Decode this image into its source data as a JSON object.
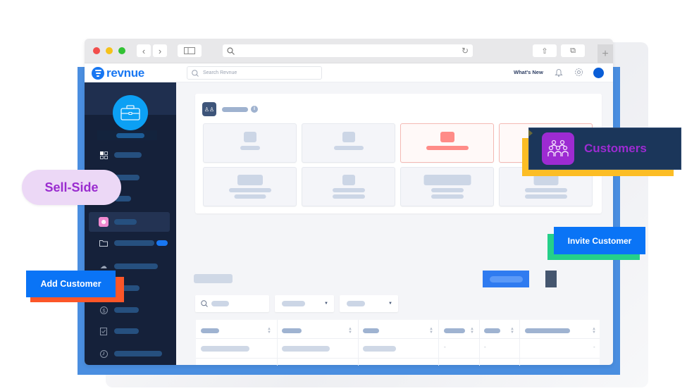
{
  "browser": {
    "url_placeholder": "",
    "icons": [
      "close",
      "minimize",
      "maximize",
      "back",
      "forward",
      "sidebar-toggle",
      "search",
      "reload",
      "share",
      "tabs",
      "new-tab"
    ]
  },
  "app": {
    "brand": "revnue",
    "search_placeholder": "Search Revnue",
    "whats_new": "What's New",
    "colors": {
      "brand": "#1877f2",
      "sidebar": "#15213a",
      "accent_purple": "#9d2bd2"
    }
  },
  "sidebar": {
    "items": [
      {
        "icon": "dashboard-grid",
        "active": false,
        "badge": false
      },
      {
        "icon": "item",
        "active": false,
        "badge": false
      },
      {
        "icon": "item",
        "active": false,
        "badge": false
      },
      {
        "icon": "customers",
        "active": true,
        "badge": false
      },
      {
        "icon": "folder",
        "active": false,
        "badge": true
      },
      {
        "icon": "cloud-settings",
        "active": false,
        "badge": false
      },
      {
        "icon": "item",
        "active": false,
        "badge": false
      },
      {
        "icon": "dollar-circle",
        "active": false,
        "badge": false
      },
      {
        "icon": "checklist",
        "active": false,
        "badge": false
      },
      {
        "icon": "clock",
        "active": false,
        "badge": false
      }
    ]
  },
  "callouts": {
    "customers": "Customers",
    "sell_side": "Sell-Side",
    "add_customer": "Add Customer",
    "invite_customer": "Invite Customer"
  },
  "main": {
    "info_icon_glyph": "i",
    "filter_caret": "▼",
    "sort_glyph": "▲▼",
    "empty_cell": "-"
  }
}
